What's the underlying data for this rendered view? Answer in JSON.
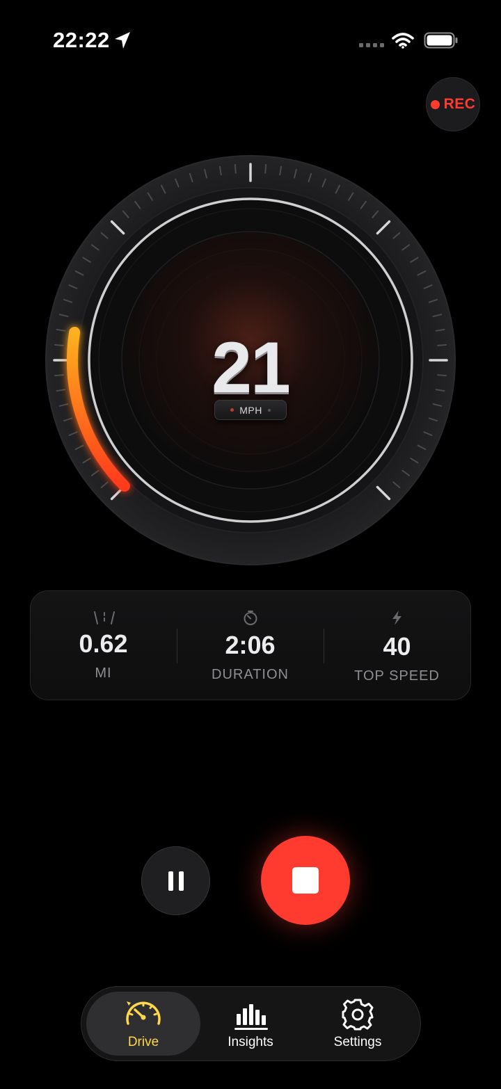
{
  "status_bar": {
    "time": "22:22",
    "icons": [
      "location-arrow-icon",
      "signal-dots-icon",
      "wifi-icon",
      "battery-icon"
    ]
  },
  "rec": {
    "label": "REC",
    "color": "#ff3b30"
  },
  "gauge": {
    "speed": "21",
    "unit": "MPH",
    "arc_fill_fraction": 0.2,
    "accent_color": "#ff7a1a"
  },
  "stats": [
    {
      "icon": "road-icon",
      "value": "0.62",
      "label": "MI"
    },
    {
      "icon": "timer-icon",
      "value": "2:06",
      "label": "DURATION"
    },
    {
      "icon": "bolt-icon",
      "value": "40",
      "label": "TOP SPEED"
    }
  ],
  "controls": {
    "pause_icon": "pause-icon",
    "stop_icon": "stop-icon",
    "stop_color": "#ff3b30"
  },
  "tabs": [
    {
      "label": "Drive",
      "icon": "speedometer-icon",
      "active": true,
      "color": "#ffd84a"
    },
    {
      "label": "Insights",
      "icon": "bar-chart-icon",
      "active": false,
      "color": "#ffffff"
    },
    {
      "label": "Settings",
      "icon": "gear-icon",
      "active": false,
      "color": "#ffffff"
    }
  ]
}
